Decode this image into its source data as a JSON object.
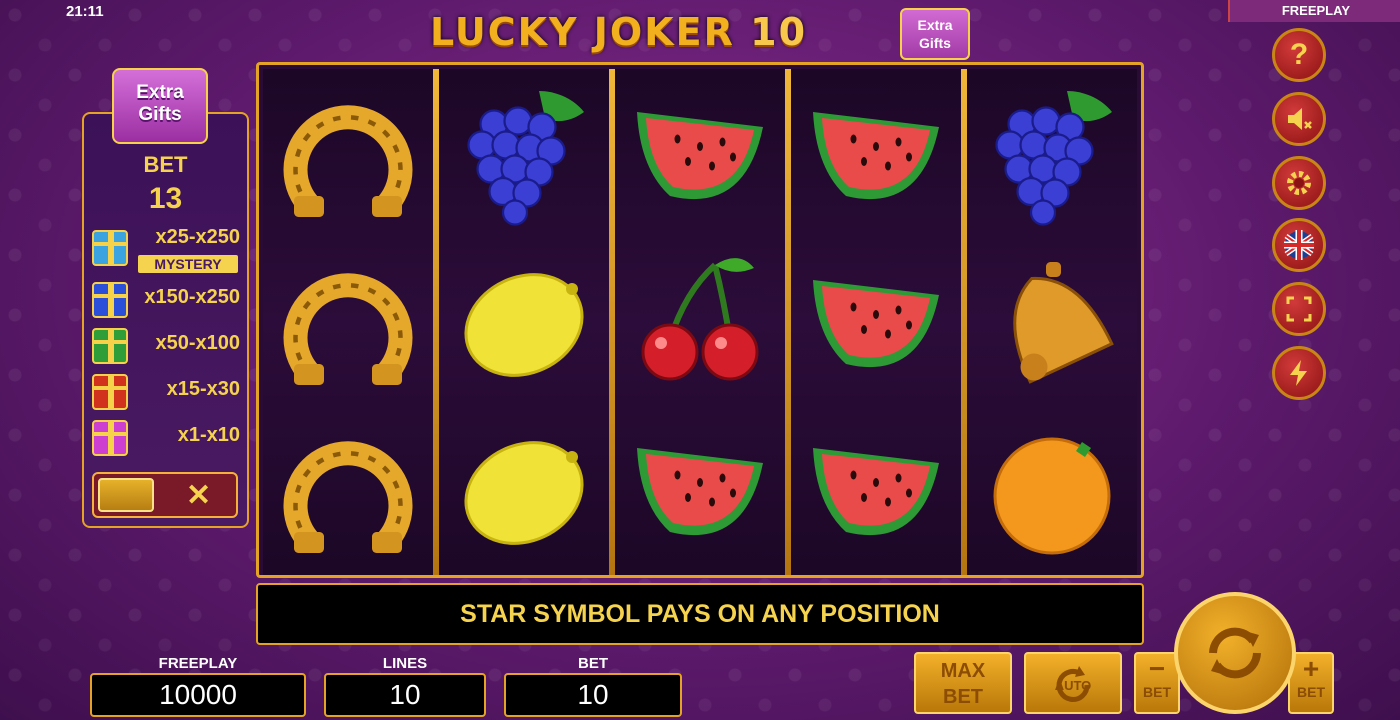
{
  "status": {
    "time": "21:11",
    "mode": "FREEPLAY"
  },
  "title": {
    "text": "LUCKY JOKER",
    "number": "10",
    "badge": "Extra Gifts"
  },
  "left_panel": {
    "logo": "Extra Gifts",
    "bet_label": "BET",
    "bet_value": "13",
    "prizes": [
      {
        "mult": "x25-x250",
        "tag": "MYSTERY",
        "color": "#3aa3e0"
      },
      {
        "mult": "x150-x250",
        "color": "#2b4fd8"
      },
      {
        "mult": "x50-x100",
        "color": "#2f9d38"
      },
      {
        "mult": "x15-x30",
        "color": "#d0321e"
      },
      {
        "mult": "x1-x10",
        "color": "#cc3fd0"
      }
    ],
    "toggle_close": "✕"
  },
  "reels": [
    [
      "horseshoe",
      "horseshoe",
      "horseshoe"
    ],
    [
      "grapes",
      "lemon",
      "lemon"
    ],
    [
      "watermelon",
      "cherries",
      "watermelon"
    ],
    [
      "watermelon",
      "watermelon",
      "watermelon"
    ],
    [
      "grapes",
      "bell",
      "orange"
    ]
  ],
  "message": "STAR SYMBOL PAYS ON ANY POSITION",
  "side_buttons": [
    "help-icon",
    "sound-muted-icon",
    "gear-icon",
    "uk-flag-icon",
    "fullscreen-icon",
    "lightning-icon"
  ],
  "side_labels": {
    "help": "?"
  },
  "bottom": {
    "freeplay_label": "FREEPLAY",
    "freeplay_value": "10000",
    "lines_label": "LINES",
    "lines_value": "10",
    "bet_label": "BET",
    "bet_value": "10",
    "max_bet_1": "MAX",
    "max_bet_2": "BET",
    "auto_label": "AUTO",
    "bet_minus_sign": "−",
    "bet_minus_label": "BET",
    "bet_plus_sign": "+",
    "bet_plus_label": "BET"
  }
}
